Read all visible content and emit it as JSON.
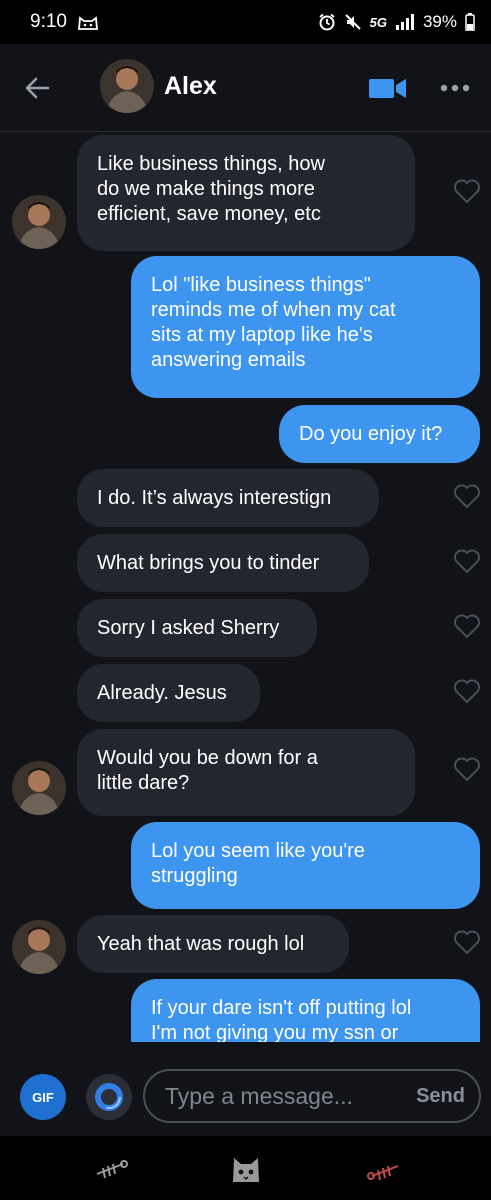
{
  "status_bar": {
    "time": "9:10",
    "network": "5G",
    "battery": "39%"
  },
  "header": {
    "back_icon": "arrow-left-icon",
    "contact_name": "Alex",
    "video_icon": "video-camera-icon",
    "more_icon": "more-dots-icon"
  },
  "messages": [
    {
      "from": "them",
      "text": "Like business things, how\ndo we make things more\nefficient, save money, etc"
    },
    {
      "from": "me",
      "text": "Lol \"like business things\"\nreminds me of when my cat\nsits at my laptop like he's\nanswering emails"
    },
    {
      "from": "me",
      "text": "Do you enjoy it?"
    },
    {
      "from": "them",
      "text": "I do. It’s always interestign"
    },
    {
      "from": "them",
      "text": "What brings you to tinder"
    },
    {
      "from": "them",
      "text": "Sorry I asked Sherry"
    },
    {
      "from": "them",
      "text": "Already. Jesus"
    },
    {
      "from": "them",
      "text": "Would you be down for a\nlittle dare?"
    },
    {
      "from": "me",
      "text": "Lol you seem like you're\nstruggling"
    },
    {
      "from": "them",
      "text": "Yeah that was rough lol"
    },
    {
      "from": "me",
      "text": "If your dare isn't off putting lol\nI'm not giving you my ssn or"
    }
  ],
  "composer": {
    "gif_label": "GIF",
    "placeholder": "Type a message...",
    "value": "",
    "send_label": "Send"
  },
  "colors": {
    "background": "#111318",
    "incoming_bubble": "#23262e",
    "outgoing_bubble": "#3d95f0",
    "accent": "#1f6fd1"
  }
}
